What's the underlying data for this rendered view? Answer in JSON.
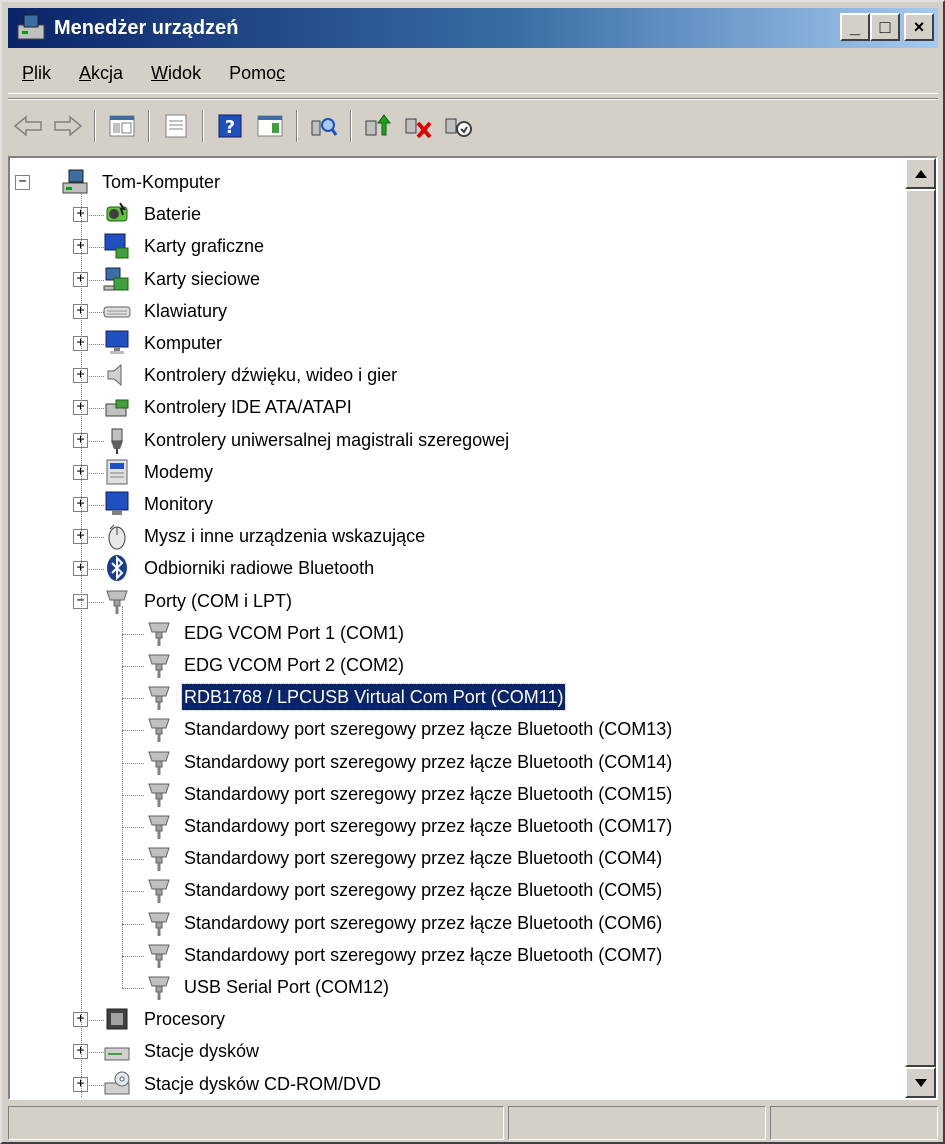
{
  "window": {
    "title": "Menedżer urządzeń",
    "minimize_glyph": "_",
    "maximize_glyph": "□",
    "close_glyph": "×"
  },
  "menu": [
    {
      "label": "Plik",
      "accel_index": 0
    },
    {
      "label": "Akcja",
      "accel_index": 0
    },
    {
      "label": "Widok",
      "accel_index": 0
    },
    {
      "label": "Pomoc",
      "accel_index": 4
    }
  ],
  "toolbar": {
    "buttons": [
      {
        "name": "back-button",
        "icon": "arrow-left-icon"
      },
      {
        "name": "forward-button",
        "icon": "arrow-right-icon"
      },
      {
        "name": "show-hide-console-tree-button",
        "icon": "console-tree-icon"
      },
      {
        "name": "properties-button",
        "icon": "properties-icon"
      },
      {
        "name": "help-button",
        "icon": "help-icon",
        "glyph": "?"
      },
      {
        "name": "action-pane-button",
        "icon": "action-pane-icon"
      },
      {
        "name": "scan-hardware-button",
        "icon": "scan-hardware-icon"
      },
      {
        "name": "update-driver-button",
        "icon": "update-driver-icon"
      },
      {
        "name": "uninstall-button",
        "icon": "uninstall-icon"
      },
      {
        "name": "disable-button",
        "icon": "disable-icon"
      }
    ]
  },
  "tree": {
    "root": {
      "label": "Tom-Komputer",
      "icon": "computer-icon",
      "expanded": true
    },
    "categories": [
      {
        "label": "Baterie",
        "icon": "battery-icon",
        "expanded": false
      },
      {
        "label": "Karty graficzne",
        "icon": "display-adapter-icon",
        "expanded": false
      },
      {
        "label": "Karty sieciowe",
        "icon": "network-adapter-icon",
        "expanded": false
      },
      {
        "label": "Klawiatury",
        "icon": "keyboard-icon",
        "expanded": false
      },
      {
        "label": "Komputer",
        "icon": "computer-monitor-icon",
        "expanded": false
      },
      {
        "label": "Kontrolery dźwięku, wideo i gier",
        "icon": "speaker-icon",
        "expanded": false
      },
      {
        "label": "Kontrolery IDE ATA/ATAPI",
        "icon": "ide-controller-icon",
        "expanded": false
      },
      {
        "label": "Kontrolery uniwersalnej magistrali szeregowej",
        "icon": "usb-plug-icon",
        "expanded": false
      },
      {
        "label": "Modemy",
        "icon": "modem-icon",
        "expanded": false
      },
      {
        "label": "Monitory",
        "icon": "monitor-icon",
        "expanded": false
      },
      {
        "label": "Mysz i inne urządzenia wskazujące",
        "icon": "mouse-icon",
        "expanded": false
      },
      {
        "label": "Odbiorniki radiowe Bluetooth",
        "icon": "bluetooth-icon",
        "expanded": false
      },
      {
        "label": "Porty (COM i LPT)",
        "icon": "port-icon",
        "expanded": true
      }
    ],
    "ports": [
      {
        "label": "EDG VCOM Port 1 (COM1)",
        "selected": false
      },
      {
        "label": "EDG VCOM Port 2 (COM2)",
        "selected": false
      },
      {
        "label": "RDB1768 / LPCUSB Virtual Com Port (COM11)",
        "selected": true
      },
      {
        "label": "Standardowy port szeregowy przez łącze Bluetooth (COM13)",
        "selected": false
      },
      {
        "label": "Standardowy port szeregowy przez łącze Bluetooth (COM14)",
        "selected": false
      },
      {
        "label": "Standardowy port szeregowy przez łącze Bluetooth (COM15)",
        "selected": false
      },
      {
        "label": "Standardowy port szeregowy przez łącze Bluetooth (COM17)",
        "selected": false
      },
      {
        "label": "Standardowy port szeregowy przez łącze Bluetooth (COM4)",
        "selected": false
      },
      {
        "label": "Standardowy port szeregowy przez łącze Bluetooth (COM5)",
        "selected": false
      },
      {
        "label": "Standardowy port szeregowy przez łącze Bluetooth (COM6)",
        "selected": false
      },
      {
        "label": "Standardowy port szeregowy przez łącze Bluetooth (COM7)",
        "selected": false
      },
      {
        "label": "USB Serial Port (COM12)",
        "selected": false
      }
    ],
    "after": [
      {
        "label": "Procesory",
        "icon": "processor-icon",
        "expanded": false
      },
      {
        "label": "Stacje dysków",
        "icon": "floppy-drive-icon",
        "expanded": false
      },
      {
        "label": "Stacje dysków CD-ROM/DVD",
        "icon": "cdrom-drive-icon",
        "expanded": false
      }
    ]
  },
  "colors": {
    "titlebar_start": "#0a246a",
    "titlebar_end": "#a6caf0",
    "selection": "#0a246a",
    "chrome": "#d4d0c8"
  }
}
